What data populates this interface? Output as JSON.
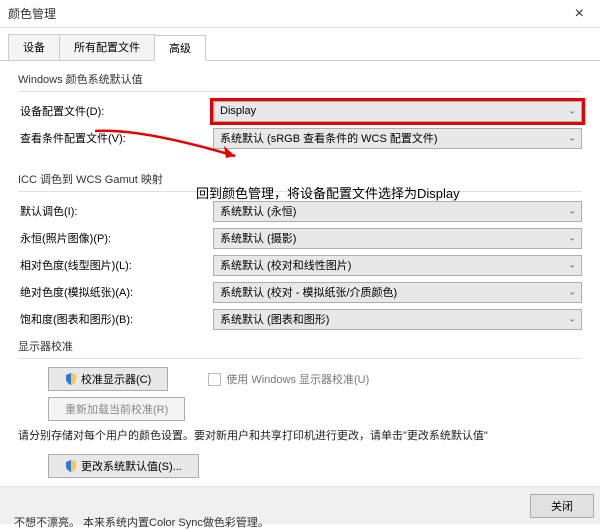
{
  "titlebar": {
    "title": "颜色管理"
  },
  "tabs": {
    "t0": "设备",
    "t1": "所有配置文件",
    "t2": "高级"
  },
  "group1": {
    "title": "Windows 颜色系统默认值",
    "row0": {
      "label": "设备配置文件(D):",
      "value": "Display"
    },
    "row1": {
      "label": "查看条件配置文件(V):",
      "value": "系统默认 (sRGB 查看条件的 WCS 配置文件)"
    }
  },
  "annotation": "回到颜色管理，将设备配置文件选择为Display",
  "group2": {
    "title": "ICC 调色到 WCS Gamut 映射",
    "row0": {
      "label": "默认调色(I):",
      "value": "系统默认 (永恒)"
    },
    "row1": {
      "label": "永恒(照片图像)(P):",
      "value": "系统默认 (摄影)"
    },
    "row2": {
      "label": "相对色度(线型图片)(L):",
      "value": "系统默认 (校对和线性图片)"
    },
    "row3": {
      "label": "绝对色度(模拟纸张)(A):",
      "value": "系统默认 (校对 - 模拟纸张/介质颜色)"
    },
    "row4": {
      "label": "饱和度(图表和图形)(B):",
      "value": "系统默认 (图表和图形)"
    }
  },
  "group3": {
    "title": "显示器校准",
    "btn1": "校准显示器(C)",
    "btn2": "重新加载当前校准(R)",
    "check": "使用 Windows 显示器校准(U)"
  },
  "desc": "请分别存储对每个用户的颜色设置。要对新用户和共享打印机进行更改，请单击\"更改系统默认值\"",
  "btn_sys": "更改系统默认值(S)...",
  "footer": {
    "close": "关闭"
  },
  "partial": "不想不漂亮。 本来系统内置Color Sync做色彩管理。"
}
